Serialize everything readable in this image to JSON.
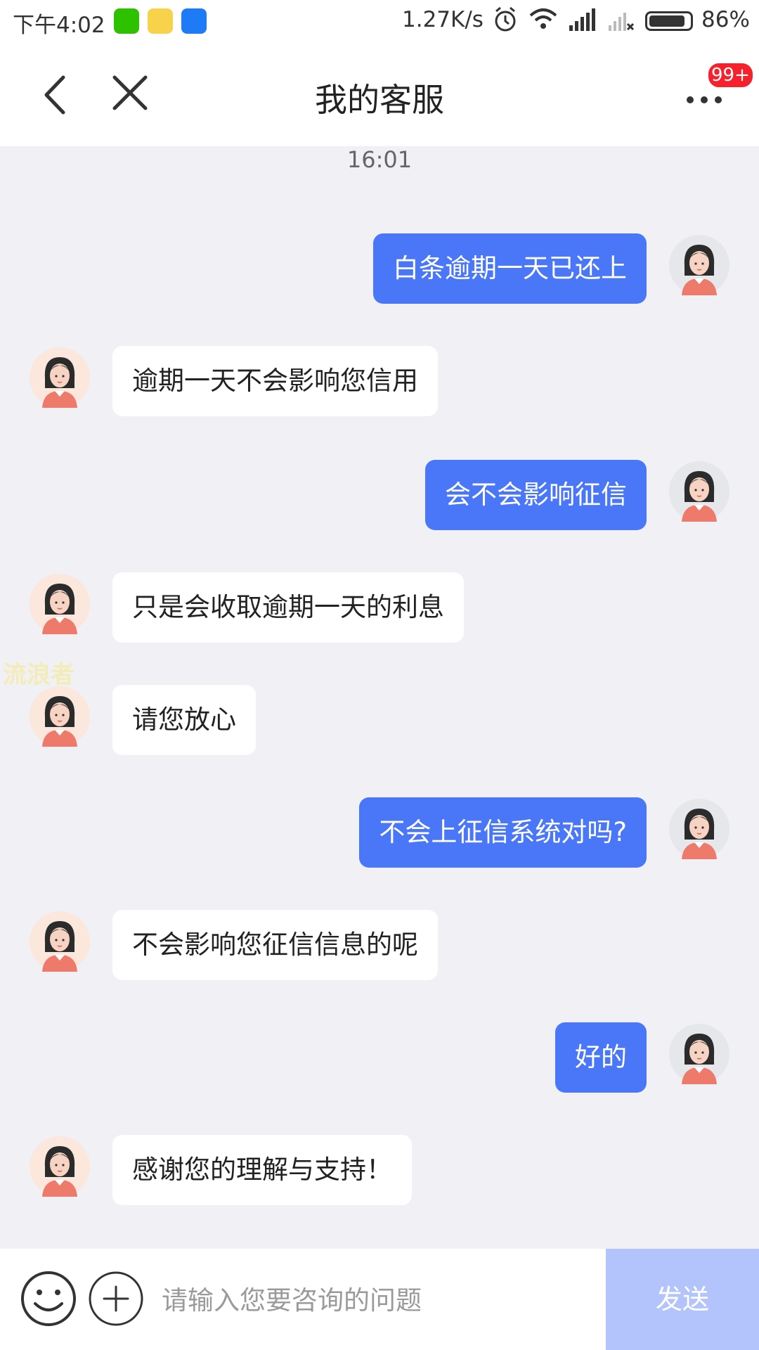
{
  "status_bar": {
    "time": "下午4:02",
    "net_speed": "1.27K/s",
    "battery": "86%",
    "app_icons": [
      "wechat-icon",
      "weibo-icon",
      "autohome-icon"
    ],
    "status_icons": [
      "alarm-icon",
      "wifi-icon",
      "signal-icon",
      "signal-none-icon",
      "battery-icon"
    ]
  },
  "header": {
    "title": "我的客服",
    "badge": "99+"
  },
  "chat": {
    "timestamp": "16:01",
    "messages": [
      {
        "from": "me",
        "text": "白条逾期一天已还上"
      },
      {
        "from": "agent",
        "text": "逾期一天不会影响您信用"
      },
      {
        "from": "me",
        "text": "会不会影响征信"
      },
      {
        "from": "agent",
        "text": "只是会收取逾期一天的利息"
      },
      {
        "from": "agent",
        "text": "请您放心"
      },
      {
        "from": "me",
        "text": "不会上征信系统对吗?"
      },
      {
        "from": "agent",
        "text": "不会影响您征信信息的呢"
      },
      {
        "from": "me",
        "text": "好的"
      },
      {
        "from": "agent",
        "text": "感谢您的理解与支持！"
      }
    ]
  },
  "watermark": "流浪者",
  "input_bar": {
    "placeholder": "请输入您要咨询的问题",
    "send_label": "发送"
  },
  "colors": {
    "my_bubble": "#4a76f8",
    "agent_bubble": "#ffffff",
    "chat_background": "#f0f0f5",
    "send_button_disabled": "#b3c3fb",
    "badge": "#f5222d"
  }
}
